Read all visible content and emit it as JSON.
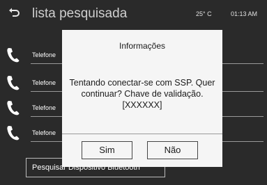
{
  "header": {
    "title": "lista pesquisada",
    "temperature": "25° C",
    "time": "01:13 AM",
    "back_icon": "back-arrow-icon"
  },
  "devices": [
    {
      "label": "Telefone",
      "icon": "phone-icon"
    },
    {
      "label": "Telefone",
      "icon": "phone-icon"
    },
    {
      "label": "Telefone",
      "icon": "phone-icon"
    },
    {
      "label": "Telefone",
      "icon": "phone-icon"
    }
  ],
  "search_button": {
    "label": "Pesquisar Dispositivo Bluetooth"
  },
  "dialog": {
    "title": "Informações",
    "message_lines": [
      "Tentando conectar-se com SSP. Quer",
      "continuar? Chave de validação.",
      "[XXXXXX]"
    ],
    "yes_label": "Sim",
    "no_label": "Não"
  },
  "colors": {
    "background": "#2a2a2a",
    "dialog_background": "#f5f5f5",
    "text_light": "#ffffff",
    "text_dark": "#1a1a1a"
  }
}
